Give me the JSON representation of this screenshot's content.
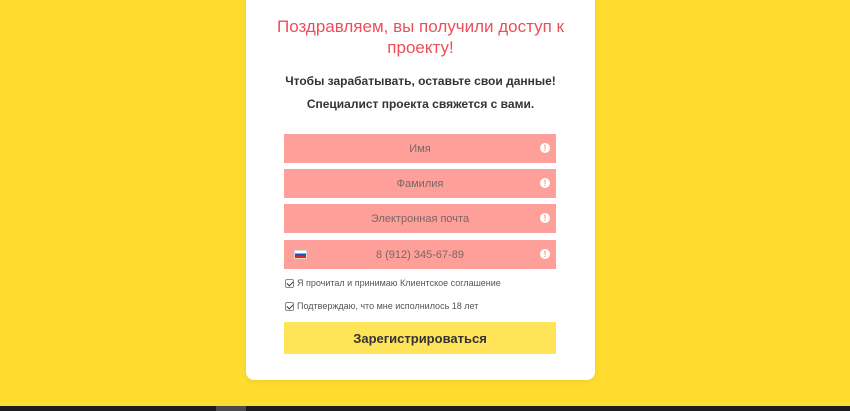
{
  "card": {
    "title": "Поздравляем, вы получили доступ к проекту!",
    "subtitle_line1": "Чтобы зарабатывать, оставьте свои данные!",
    "subtitle_line2": "Специалист проекта свяжется с вами."
  },
  "form": {
    "first_name": {
      "placeholder": "Имя",
      "value": ""
    },
    "last_name": {
      "placeholder": "Фамилия",
      "value": ""
    },
    "email": {
      "placeholder": "Электронная почта",
      "value": ""
    },
    "phone": {
      "placeholder": "8 (912) 345-67-89",
      "value": "",
      "country": "RU"
    },
    "warning_glyph": "!",
    "consent_agreement": {
      "label": "Я прочитал и принимаю Клиентское соглашение",
      "checked": true
    },
    "consent_age": {
      "label": "Подтверждаю, что мне исполнилось 18 лет",
      "checked": true
    },
    "submit_label": "Зарегистрироваться"
  },
  "colors": {
    "background": "#ffdc2e",
    "title": "#ee4e5a",
    "field_error_bg": "#ff9f99",
    "submit_bg": "#ffe45a"
  }
}
